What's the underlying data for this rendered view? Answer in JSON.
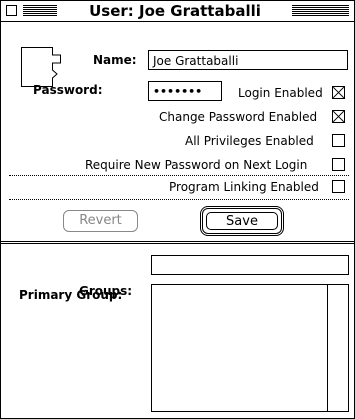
{
  "window": {
    "title": "User: Joe Grattaballi"
  },
  "form": {
    "name_label": "Name:",
    "name_value": "Joe Grattaballi",
    "password_label": "Password:",
    "password_value": "•••••••",
    "login_enabled_label": "Login Enabled",
    "login_enabled": true,
    "change_password_label": "Change Password Enabled",
    "change_password": true,
    "all_privileges_label": "All Privileges Enabled",
    "all_privileges": false,
    "require_new_password_label": "Require New Password on Next Login",
    "require_new_password": false,
    "program_linking_label": "Program Linking Enabled",
    "program_linking": false
  },
  "buttons": {
    "revert_label": "Revert",
    "save_label": "Save"
  },
  "groups": {
    "primary_group_label": "Primary Group:",
    "primary_group_value": "",
    "groups_label": "Groups:",
    "groups_items": []
  },
  "icons": {
    "close_box": "close-box-icon",
    "user": "user-icon"
  }
}
